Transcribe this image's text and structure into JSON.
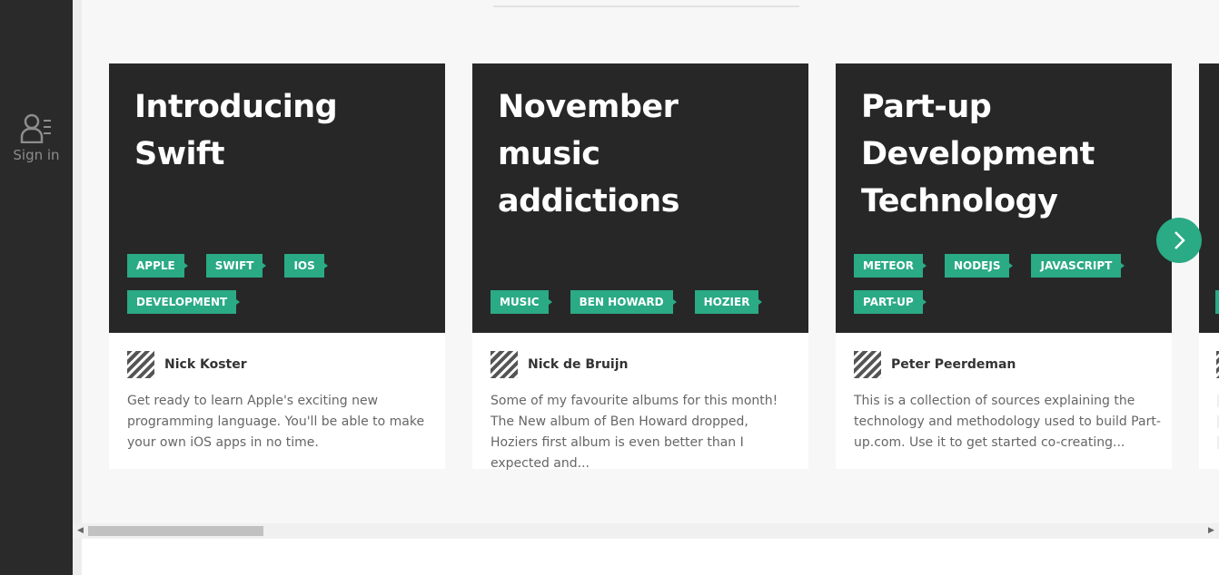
{
  "sidebar": {
    "signin_label": "Sign in",
    "signin_icon": "user-list-icon"
  },
  "cards": [
    {
      "title": "Introducing Swift",
      "tags": [
        "APPLE",
        "SWIFT",
        "IOS",
        "DEVELOPMENT"
      ],
      "author": "Nick Koster",
      "excerpt": "Get ready to learn Apple's exciting new programming language. You'll be able to make your own iOS apps in no time."
    },
    {
      "title": "November music addictions",
      "tags": [
        "MUSIC",
        "BEN HOWARD",
        "HOZIER"
      ],
      "author": "Nick de Bruijn",
      "excerpt": "Some of my favourite albums for this month! The New album of Ben Howard dropped, Hoziers first album is even better than I expected and..."
    },
    {
      "title": "Part-up Development Technology",
      "tags": [
        "METEOR",
        "NODEJS",
        "JAVASCRIPT",
        "PART-UP"
      ],
      "author": "Peter Peerdeman",
      "excerpt": "This is a collection of sources explaining the technology and methodology used to build Part-up.com. Use it to get started co-creating..."
    }
  ],
  "carousel": {
    "next_icon": "chevron-right-icon"
  },
  "colors": {
    "accent": "#2aaa85",
    "card_head": "#272727",
    "sidebar": "#2a2a2a"
  }
}
